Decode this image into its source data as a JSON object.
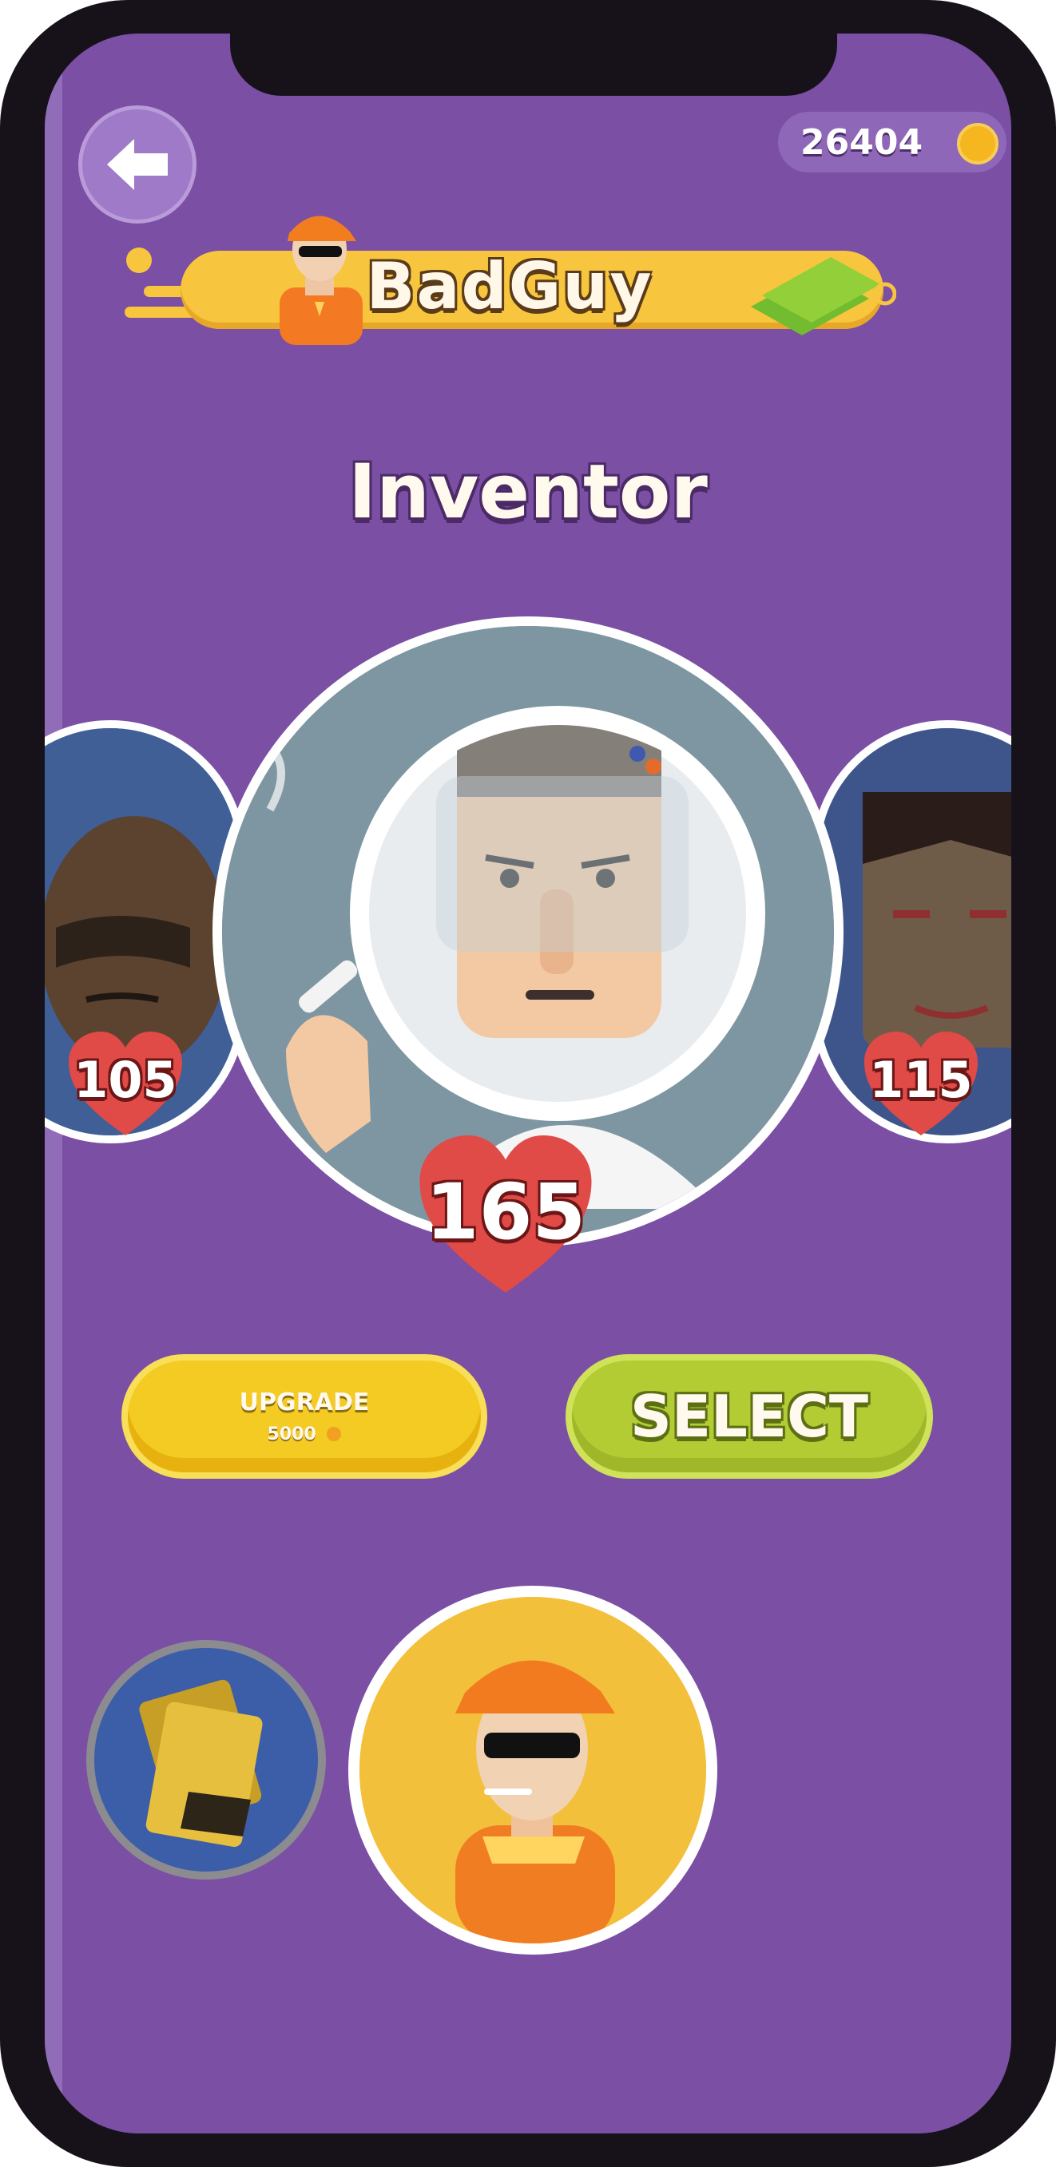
{
  "header": {
    "coins": "26404",
    "player_name": "BadGuy"
  },
  "title": "Inventor",
  "characters": {
    "left": {
      "health": "105"
    },
    "center": {
      "health": "165"
    },
    "right": {
      "health": "115"
    }
  },
  "buttons": {
    "upgrade_label": "UPGRADE",
    "upgrade_cost": "5000",
    "select_label": "SELECT"
  },
  "icons": {
    "back": "back-arrow-icon",
    "coin": "coin-icon",
    "heart": "heart-icon",
    "cash": "cash-stack-icon",
    "cards": "cards-icon"
  },
  "colors": {
    "background": "#7a4fa4",
    "banner": "#f7c53e",
    "upgrade": "#f4cb22",
    "select": "#b4cc34",
    "heart": "#e04a47"
  }
}
